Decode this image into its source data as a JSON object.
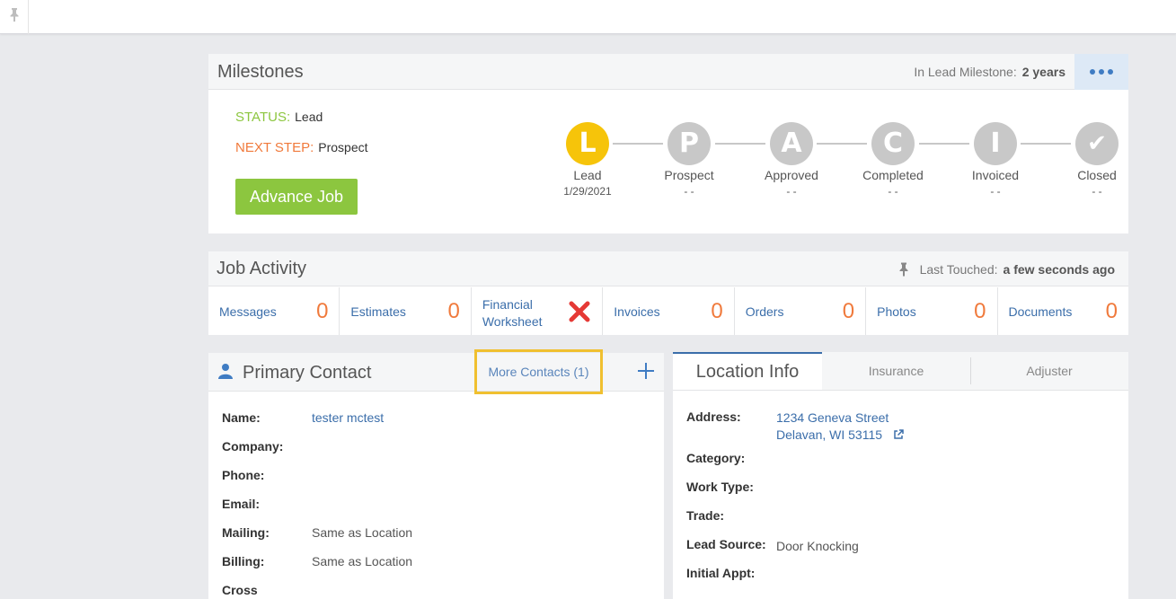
{
  "topbar": {
    "pin_icon": "pin-icon"
  },
  "milestones": {
    "title": "Milestones",
    "in_lead_label": "In Lead Milestone:",
    "in_lead_value": "2 years",
    "status_label": "STATUS:",
    "status_value": "Lead",
    "next_step_label": "NEXT STEP:",
    "next_step_value": "Prospect",
    "advance_label": "Advance Job",
    "steps": [
      {
        "letter": "L",
        "name": "Lead",
        "date": "1/29/2021",
        "active": true
      },
      {
        "letter": "P",
        "name": "Prospect",
        "date": "- -",
        "active": false
      },
      {
        "letter": "A",
        "name": "Approved",
        "date": "- -",
        "active": false
      },
      {
        "letter": "C",
        "name": "Completed",
        "date": "- -",
        "active": false
      },
      {
        "letter": "I",
        "name": "Invoiced",
        "date": "- -",
        "active": false
      },
      {
        "letter": "✔",
        "name": "Closed",
        "date": "- -",
        "active": false
      }
    ],
    "colors": {
      "active": "#f6c40a",
      "inactive": "#c8c8c8",
      "status": "#8cc63f",
      "next": "#f07a3c"
    }
  },
  "activity": {
    "title": "Job Activity",
    "last_touched_label": "Last Touched:",
    "last_touched_value": "a few seconds ago",
    "items": [
      {
        "label": "Messages",
        "count": "0"
      },
      {
        "label": "Estimates",
        "count": "0"
      },
      {
        "label": "Financial Worksheet",
        "line1": "Financial",
        "line2": "Worksheet",
        "status_icon": "red-x-icon"
      },
      {
        "label": "Invoices",
        "count": "0"
      },
      {
        "label": "Orders",
        "count": "0"
      },
      {
        "label": "Photos",
        "count": "0"
      },
      {
        "label": "Documents",
        "count": "0"
      }
    ]
  },
  "contact": {
    "title": "Primary Contact",
    "more_contacts_label": "More Contacts (1)",
    "fields": {
      "name_label": "Name:",
      "name_value": "tester mctest",
      "company_label": "Company:",
      "phone_label": "Phone:",
      "email_label": "Email:",
      "mailing_label": "Mailing:",
      "mailing_value": "Same as Location",
      "billing_label": "Billing:",
      "billing_value": "Same as Location",
      "cross_label": "Cross"
    }
  },
  "location": {
    "tabs": [
      "Location Info",
      "Insurance",
      "Adjuster"
    ],
    "address_label": "Address:",
    "address_line1": "1234 Geneva Street",
    "address_line2": "Delavan, WI 53115",
    "category_label": "Category:",
    "work_type_label": "Work Type:",
    "trade_label": "Trade:",
    "lead_source_label": "Lead Source:",
    "lead_source_value": "Door Knocking",
    "initial_appt_label": "Initial Appt:"
  }
}
